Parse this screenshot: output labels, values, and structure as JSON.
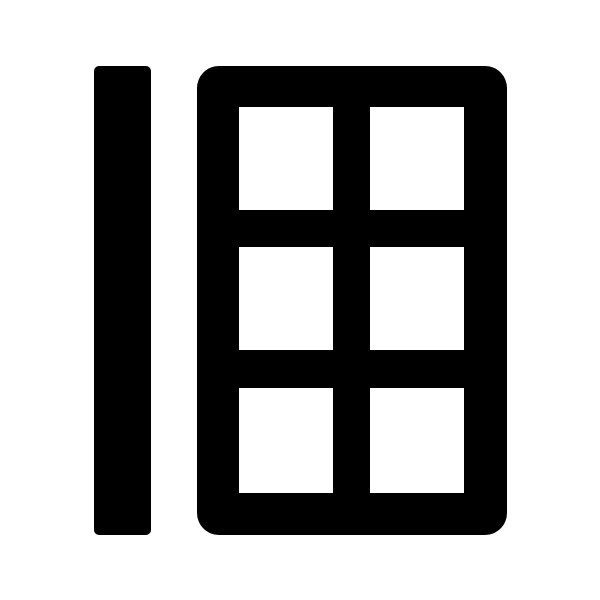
{
  "icon": {
    "name": "sidebar-grid-layout-icon",
    "parts": {
      "sidebar_bar": "vertical-bar",
      "grid_panel": "rounded-panel",
      "grid_rows": 3,
      "grid_columns": 2
    },
    "colors": {
      "foreground": "#000000",
      "background": "#ffffff"
    }
  }
}
